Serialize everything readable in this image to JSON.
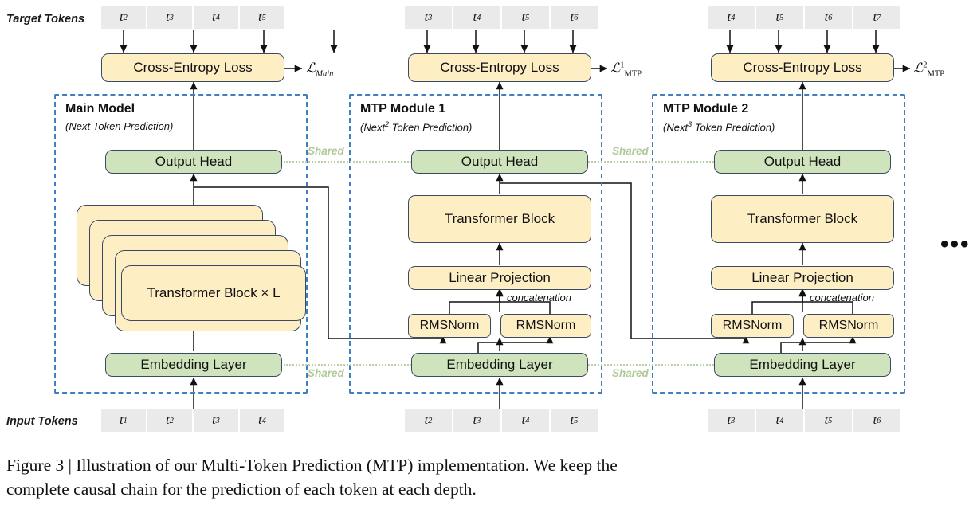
{
  "figure": {
    "caption_line1": "Figure 3 | Illustration of our Multi-Token Prediction (MTP) implementation.  We keep the",
    "caption_line2": "complete causal chain for the prediction of each token at each depth.",
    "ellipsis": "•••"
  },
  "axis_labels": {
    "target_tokens": "Target Tokens",
    "input_tokens": "Input Tokens"
  },
  "colors": {
    "module_frame": "#3f7fc4",
    "box_yellow": "#fdeec4",
    "box_green": "#cfe3bd",
    "box_border": "#3a4a62",
    "token_cell": "#eaeaea",
    "shared_dotted": "#b9cfa5",
    "shared_label": "#b0c99a"
  },
  "shared_labels": {
    "output_head_left": "Shared",
    "output_head_right": "Shared",
    "embedding_left": "Shared",
    "embedding_right": "Shared"
  },
  "columns": [
    {
      "id": "main",
      "title": "Main Model",
      "subtitle_pre": "(Next",
      "subtitle_sup": "",
      "subtitle_post": " Token Prediction)",
      "loss_symbol": "ℒ",
      "loss_sub": "Main",
      "loss_sup": "",
      "target_tokens": [
        "t2",
        "t3",
        "t4",
        "t5"
      ],
      "input_tokens": [
        "t1",
        "t2",
        "t3",
        "t4"
      ],
      "loss_box": "Cross-Entropy Loss",
      "output_head": "Output Head",
      "trunk": "Transformer Block × L",
      "embedding": "Embedding Layer"
    },
    {
      "id": "mtp1",
      "title": "MTP Module 1",
      "subtitle_pre": "(Next",
      "subtitle_sup": "2",
      "subtitle_post": " Token Prediction)",
      "loss_symbol": "ℒ",
      "loss_sub": "MTP",
      "loss_sup": "1",
      "target_tokens": [
        "t3",
        "t4",
        "t5",
        "t6"
      ],
      "input_tokens": [
        "t2",
        "t3",
        "t4",
        "t5"
      ],
      "loss_box": "Cross-Entropy Loss",
      "output_head": "Output Head",
      "transformer_block": "Transformer Block",
      "linear_projection": "Linear Projection",
      "rmsnorm_left": "RMSNorm",
      "rmsnorm_right": "RMSNorm",
      "concatenation": "concatenation",
      "embedding": "Embedding Layer"
    },
    {
      "id": "mtp2",
      "title": "MTP Module 2",
      "subtitle_pre": "(Next",
      "subtitle_sup": "3",
      "subtitle_post": " Token Prediction)",
      "loss_symbol": "ℒ",
      "loss_sub": "MTP",
      "loss_sup": "2",
      "target_tokens": [
        "t4",
        "t5",
        "t6",
        "t7"
      ],
      "input_tokens": [
        "t3",
        "t4",
        "t5",
        "t6"
      ],
      "loss_box": "Cross-Entropy Loss",
      "output_head": "Output Head",
      "transformer_block": "Transformer Block",
      "linear_projection": "Linear Projection",
      "rmsnorm_left": "RMSNorm",
      "rmsnorm_right": "RMSNorm",
      "concatenation": "concatenation",
      "embedding": "Embedding Layer"
    }
  ]
}
